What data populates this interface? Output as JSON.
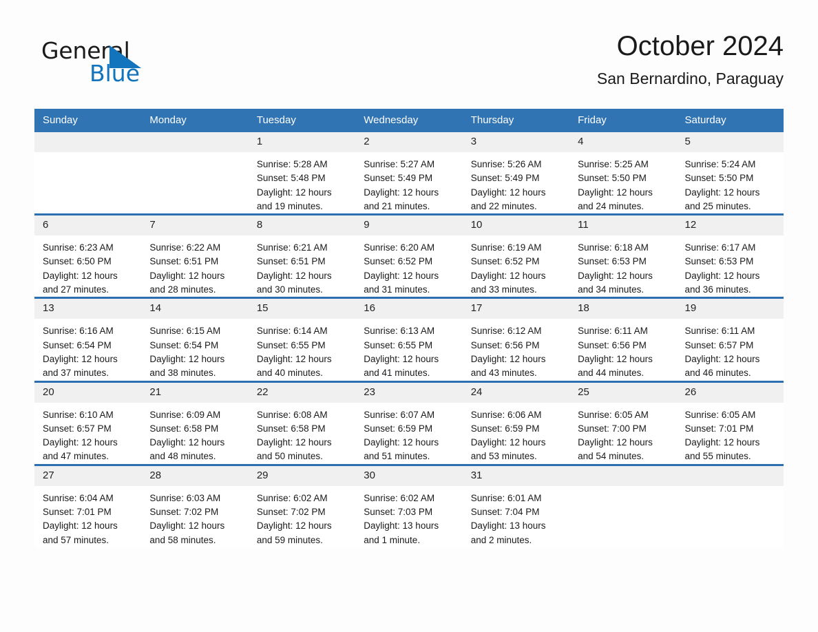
{
  "brand": {
    "name_part1": "General",
    "name_part2": "Blue",
    "triangle_color": "#1274bc",
    "icon": "blue-triangle-logo-mark"
  },
  "header": {
    "title": "October 2024",
    "location": "San Bernardino, Paraguay"
  },
  "theme": {
    "header_blue": "#3074b4",
    "row_divider_blue": "#2c6fb0",
    "daynum_band": "#f0f0f0",
    "text": "#1a1a1a",
    "page_background": "#fdfdfd"
  },
  "calendar": {
    "weekday_headers": [
      "Sunday",
      "Monday",
      "Tuesday",
      "Wednesday",
      "Thursday",
      "Friday",
      "Saturday"
    ],
    "weeks": [
      [
        {
          "day": "",
          "lines": []
        },
        {
          "day": "",
          "lines": []
        },
        {
          "day": "1",
          "lines": [
            "Sunrise: 5:28 AM",
            "Sunset: 5:48 PM",
            "Daylight: 12 hours",
            "and 19 minutes."
          ]
        },
        {
          "day": "2",
          "lines": [
            "Sunrise: 5:27 AM",
            "Sunset: 5:49 PM",
            "Daylight: 12 hours",
            "and 21 minutes."
          ]
        },
        {
          "day": "3",
          "lines": [
            "Sunrise: 5:26 AM",
            "Sunset: 5:49 PM",
            "Daylight: 12 hours",
            "and 22 minutes."
          ]
        },
        {
          "day": "4",
          "lines": [
            "Sunrise: 5:25 AM",
            "Sunset: 5:50 PM",
            "Daylight: 12 hours",
            "and 24 minutes."
          ]
        },
        {
          "day": "5",
          "lines": [
            "Sunrise: 5:24 AM",
            "Sunset: 5:50 PM",
            "Daylight: 12 hours",
            "and 25 minutes."
          ]
        }
      ],
      [
        {
          "day": "6",
          "lines": [
            "Sunrise: 6:23 AM",
            "Sunset: 6:50 PM",
            "Daylight: 12 hours",
            "and 27 minutes."
          ]
        },
        {
          "day": "7",
          "lines": [
            "Sunrise: 6:22 AM",
            "Sunset: 6:51 PM",
            "Daylight: 12 hours",
            "and 28 minutes."
          ]
        },
        {
          "day": "8",
          "lines": [
            "Sunrise: 6:21 AM",
            "Sunset: 6:51 PM",
            "Daylight: 12 hours",
            "and 30 minutes."
          ]
        },
        {
          "day": "9",
          "lines": [
            "Sunrise: 6:20 AM",
            "Sunset: 6:52 PM",
            "Daylight: 12 hours",
            "and 31 minutes."
          ]
        },
        {
          "day": "10",
          "lines": [
            "Sunrise: 6:19 AM",
            "Sunset: 6:52 PM",
            "Daylight: 12 hours",
            "and 33 minutes."
          ]
        },
        {
          "day": "11",
          "lines": [
            "Sunrise: 6:18 AM",
            "Sunset: 6:53 PM",
            "Daylight: 12 hours",
            "and 34 minutes."
          ]
        },
        {
          "day": "12",
          "lines": [
            "Sunrise: 6:17 AM",
            "Sunset: 6:53 PM",
            "Daylight: 12 hours",
            "and 36 minutes."
          ]
        }
      ],
      [
        {
          "day": "13",
          "lines": [
            "Sunrise: 6:16 AM",
            "Sunset: 6:54 PM",
            "Daylight: 12 hours",
            "and 37 minutes."
          ]
        },
        {
          "day": "14",
          "lines": [
            "Sunrise: 6:15 AM",
            "Sunset: 6:54 PM",
            "Daylight: 12 hours",
            "and 38 minutes."
          ]
        },
        {
          "day": "15",
          "lines": [
            "Sunrise: 6:14 AM",
            "Sunset: 6:55 PM",
            "Daylight: 12 hours",
            "and 40 minutes."
          ]
        },
        {
          "day": "16",
          "lines": [
            "Sunrise: 6:13 AM",
            "Sunset: 6:55 PM",
            "Daylight: 12 hours",
            "and 41 minutes."
          ]
        },
        {
          "day": "17",
          "lines": [
            "Sunrise: 6:12 AM",
            "Sunset: 6:56 PM",
            "Daylight: 12 hours",
            "and 43 minutes."
          ]
        },
        {
          "day": "18",
          "lines": [
            "Sunrise: 6:11 AM",
            "Sunset: 6:56 PM",
            "Daylight: 12 hours",
            "and 44 minutes."
          ]
        },
        {
          "day": "19",
          "lines": [
            "Sunrise: 6:11 AM",
            "Sunset: 6:57 PM",
            "Daylight: 12 hours",
            "and 46 minutes."
          ]
        }
      ],
      [
        {
          "day": "20",
          "lines": [
            "Sunrise: 6:10 AM",
            "Sunset: 6:57 PM",
            "Daylight: 12 hours",
            "and 47 minutes."
          ]
        },
        {
          "day": "21",
          "lines": [
            "Sunrise: 6:09 AM",
            "Sunset: 6:58 PM",
            "Daylight: 12 hours",
            "and 48 minutes."
          ]
        },
        {
          "day": "22",
          "lines": [
            "Sunrise: 6:08 AM",
            "Sunset: 6:58 PM",
            "Daylight: 12 hours",
            "and 50 minutes."
          ]
        },
        {
          "day": "23",
          "lines": [
            "Sunrise: 6:07 AM",
            "Sunset: 6:59 PM",
            "Daylight: 12 hours",
            "and 51 minutes."
          ]
        },
        {
          "day": "24",
          "lines": [
            "Sunrise: 6:06 AM",
            "Sunset: 6:59 PM",
            "Daylight: 12 hours",
            "and 53 minutes."
          ]
        },
        {
          "day": "25",
          "lines": [
            "Sunrise: 6:05 AM",
            "Sunset: 7:00 PM",
            "Daylight: 12 hours",
            "and 54 minutes."
          ]
        },
        {
          "day": "26",
          "lines": [
            "Sunrise: 6:05 AM",
            "Sunset: 7:01 PM",
            "Daylight: 12 hours",
            "and 55 minutes."
          ]
        }
      ],
      [
        {
          "day": "27",
          "lines": [
            "Sunrise: 6:04 AM",
            "Sunset: 7:01 PM",
            "Daylight: 12 hours",
            "and 57 minutes."
          ]
        },
        {
          "day": "28",
          "lines": [
            "Sunrise: 6:03 AM",
            "Sunset: 7:02 PM",
            "Daylight: 12 hours",
            "and 58 minutes."
          ]
        },
        {
          "day": "29",
          "lines": [
            "Sunrise: 6:02 AM",
            "Sunset: 7:02 PM",
            "Daylight: 12 hours",
            "and 59 minutes."
          ]
        },
        {
          "day": "30",
          "lines": [
            "Sunrise: 6:02 AM",
            "Sunset: 7:03 PM",
            "Daylight: 13 hours",
            "and 1 minute."
          ]
        },
        {
          "day": "31",
          "lines": [
            "Sunrise: 6:01 AM",
            "Sunset: 7:04 PM",
            "Daylight: 13 hours",
            "and 2 minutes."
          ]
        },
        {
          "day": "",
          "lines": []
        },
        {
          "day": "",
          "lines": []
        }
      ]
    ]
  }
}
